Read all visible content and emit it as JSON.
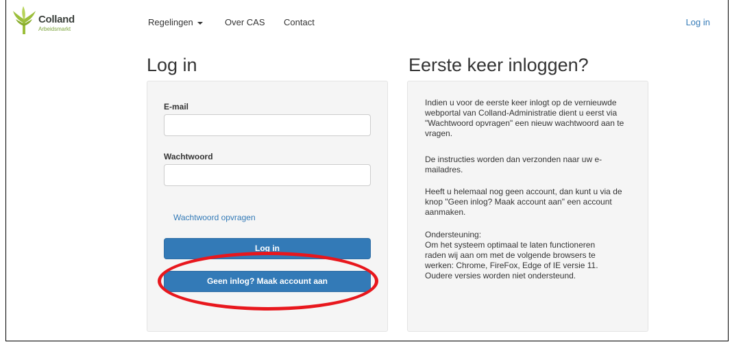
{
  "logo": {
    "name": "Colland",
    "sub": "Arbeidsmarkt",
    "colors": {
      "green": "#9cbf3b",
      "dark": "#3a3f3b"
    }
  },
  "nav": {
    "items": [
      {
        "label": "Regelingen",
        "dropdown": true
      },
      {
        "label": "Over CAS"
      },
      {
        "label": "Contact"
      }
    ],
    "login": "Log in"
  },
  "login": {
    "title": "Log in",
    "email_label": "E-mail",
    "email_value": "",
    "password_label": "Wachtwoord",
    "password_value": "",
    "forgot_link": "Wachtwoord opvragen",
    "login_button": "Log in",
    "create_account_button": "Geen inlog? Maak account aan"
  },
  "first_time": {
    "title": "Eerste keer inloggen?",
    "paragraphs": [
      "Indien u voor de eerste keer inlogt op de vernieuwde webportal van Colland-Administratie dient u eerst via \"Wachtwoord opvragen\" een nieuw wachtwoord aan te vragen.",
      "De instructies worden dan verzonden naar uw e-mailadres.",
      "Heeft u helemaal nog geen account, dan kunt u via de knop \"Geen inlog? Maak account aan\" een account aanmaken."
    ],
    "support_heading": "Ondersteuning:",
    "support_lines": [
      "Om het systeem optimaal te laten functioneren",
      "raden wij aan om met de volgende browsers te",
      "werken: Chrome, FireFox, Edge of IE versie 11.",
      "Oudere versies worden niet ondersteund."
    ]
  },
  "colors": {
    "primary": "#337ab7",
    "highlight": "#e8171d",
    "panel": "#f5f5f5"
  }
}
